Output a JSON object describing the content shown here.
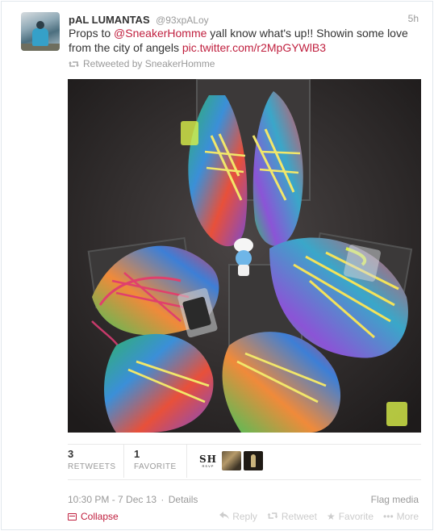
{
  "tweet": {
    "fullname": "pAL LUMANTAS",
    "username": "@93xpALoy",
    "time": "5h",
    "text_prefix": "Props to ",
    "mention": "@SneakerHomme",
    "text_middle": " yall know what's up!! Showin some love from the city of angels ",
    "pic_link": "pic.twitter.com/r2MpGYWlB3",
    "retweeted_by": "Retweeted by SneakerHomme"
  },
  "stats": {
    "retweets_count": "3",
    "retweets_label": "RETWEETS",
    "favorites_count": "1",
    "favorites_label": "FAVORITE"
  },
  "favoriters": [
    {
      "name": "sneakerhomme-avatar",
      "logo_text": "SH",
      "logo_sub": "RSVP"
    },
    {
      "name": "favoriter-avatar-2"
    },
    {
      "name": "favoriter-avatar-3"
    }
  ],
  "meta": {
    "timestamp": "10:30 PM - 7 Dec 13",
    "separator": "·",
    "details": "Details",
    "flag_media": "Flag media"
  },
  "actions": {
    "collapse": "Collapse",
    "reply": "Reply",
    "retweet": "Retweet",
    "favorite": "Favorite",
    "more": "More"
  },
  "colors": {
    "link": "#c0203f",
    "muted": "#999999",
    "text": "#333333"
  },
  "icons": {
    "reply": "reply-arrow-icon",
    "retweet": "retweet-icon",
    "favorite": "star-icon",
    "more": "ellipsis-icon",
    "collapse": "collapse-icon",
    "retweeted": "retweet-icon"
  }
}
